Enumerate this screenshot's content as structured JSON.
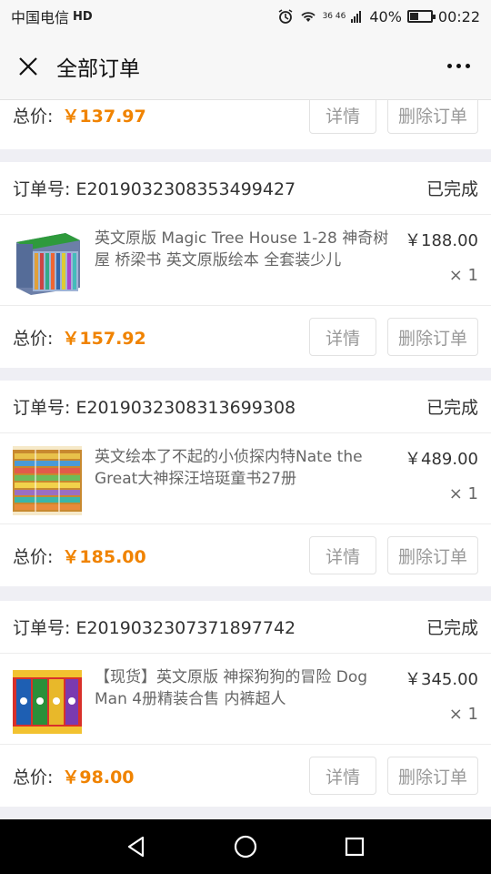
{
  "status_bar": {
    "carrier": "中国电信",
    "hd_label": "HD",
    "battery": "40%",
    "battery_level": 0.4,
    "time": "00:22",
    "signal_text": "36 46"
  },
  "header": {
    "title": "全部订单"
  },
  "labels": {
    "order_no_prefix": "订单号: ",
    "total_label": "总价: ",
    "detail_button": "详情",
    "delete_button": "删除订单"
  },
  "partial_order": {
    "total": "￥137.97"
  },
  "orders": [
    {
      "order_no": "E2019032308353499427",
      "status": "已完成",
      "title": "英文原版 Magic Tree House 1-28 神奇树屋 桥梁书 英文原版绘本 全套装少儿",
      "price": "￥188.00",
      "qty": "× 1",
      "total": "￥157.92"
    },
    {
      "order_no": "E2019032308313699308",
      "status": "已完成",
      "title": "英文绘本了不起的小侦探内特Nate the Great大神探汪培珽童书27册",
      "price": "￥489.00",
      "qty": "× 1",
      "total": "￥185.00"
    },
    {
      "order_no": "E2019032307371897742",
      "status": "已完成",
      "title": "【现货】英文原版 神探狗狗的冒险 Dog Man 4册精装合售 内裤超人",
      "price": "￥345.00",
      "qty": "× 1",
      "total": "￥98.00"
    }
  ],
  "colors": {
    "accent_price": "#f08300",
    "background": "#efeff4"
  }
}
